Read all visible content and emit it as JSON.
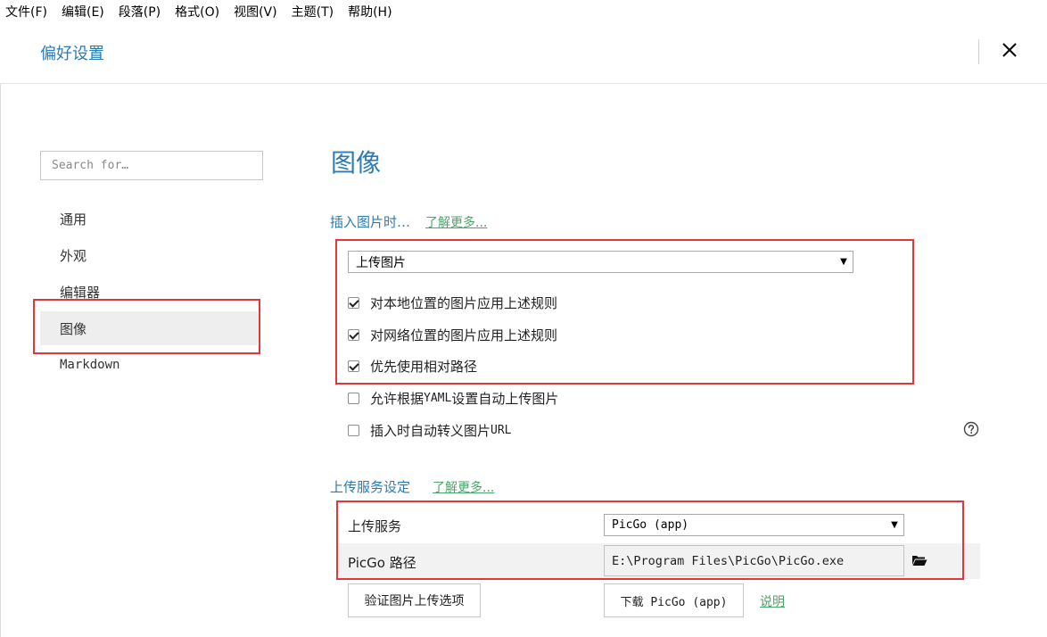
{
  "menu": [
    "文件(F)",
    "编辑(E)",
    "段落(P)",
    "格式(O)",
    "视图(V)",
    "主题(T)",
    "帮助(H)"
  ],
  "header": {
    "title": "偏好设置",
    "close_icon": "close-icon"
  },
  "sidebar": {
    "search_placeholder": "Search for…",
    "items": [
      {
        "label": "通用",
        "active": false
      },
      {
        "label": "外观",
        "active": false
      },
      {
        "label": "编辑器",
        "active": false
      },
      {
        "label": "图像",
        "active": true
      },
      {
        "label": "Markdown",
        "active": false
      }
    ]
  },
  "main": {
    "heading": "图像",
    "insert_section": {
      "title": "插入图片时…",
      "learn_more": "了解更多...",
      "action_select": "上传图片",
      "options": [
        {
          "label": "对本地位置的图片应用上述规则",
          "checked": true
        },
        {
          "label": "对网络位置的图片应用上述规则",
          "checked": true
        },
        {
          "label": "优先使用相对路径",
          "checked": true
        },
        {
          "label_pre": "允许根据 ",
          "label_code": "YAML",
          "label_post": " 设置自动上传图片",
          "checked": false
        },
        {
          "label_pre": "插入时自动转义图片 ",
          "label_code": "URL",
          "label_post": "",
          "checked": false
        }
      ]
    },
    "upload_section": {
      "title": "上传服务设定",
      "learn_more": "了解更多...",
      "service_label": "上传服务",
      "service_value": "PicGo (app)",
      "path_label": "PicGo 路径",
      "path_value": "E:\\Program Files\\PicGo\\PicGo.exe",
      "verify_button": "验证图片上传选项",
      "download_button": "下载 PicGo (app)",
      "help_link": "说明"
    }
  },
  "colors": {
    "accent": "#2a7bb6",
    "link": "#4aa66a",
    "highlight": "#e0383a"
  }
}
